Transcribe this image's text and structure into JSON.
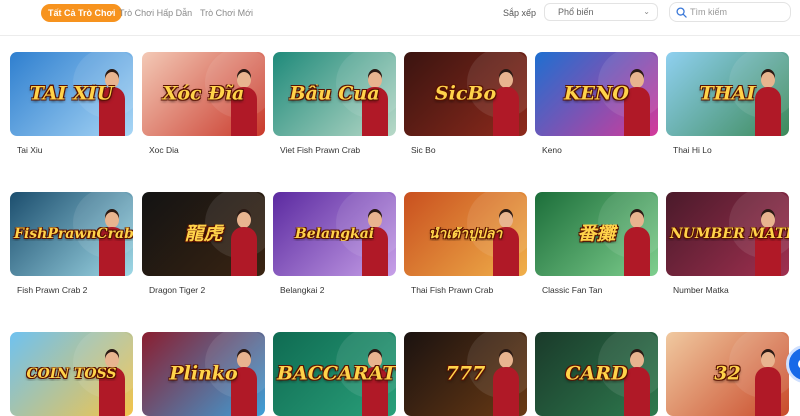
{
  "tabs": [
    {
      "label": "Tất Cả Trò Chơi",
      "active": true
    },
    {
      "label": "Trò Chơi Hấp Dẫn",
      "active": false
    },
    {
      "label": "Trò Chơi Mới",
      "active": false
    }
  ],
  "sort": {
    "label": "Sắp xếp",
    "value": "Phổ biến",
    "icon": "chevron-down-icon"
  },
  "search": {
    "placeholder": "Tìm kiếm",
    "value": "",
    "icon": "search-icon"
  },
  "accent_color": "#f7931e",
  "games": [
    {
      "name": "Tai Xiu",
      "art": "TÀI XỈU",
      "bg": "#2f7fcf",
      "bg2": "#a8d6f5"
    },
    {
      "name": "Xoc Dia",
      "art": "Xóc Đĩa",
      "bg": "#f3c9b6",
      "bg2": "#c9392b"
    },
    {
      "name": "Viet Fish Prawn Crab",
      "art": "Bầu Cua",
      "bg": "#1f8a7a",
      "bg2": "#b8d9c8"
    },
    {
      "name": "Sic Bo",
      "art": "SicBo",
      "bg": "#3a1410",
      "bg2": "#8e2a1c"
    },
    {
      "name": "Keno",
      "art": "KENO",
      "bg": "#1e6fd0",
      "bg2": "#d43a9a"
    },
    {
      "name": "Thai Hi Lo",
      "art": "THAI",
      "bg": "#8fd0f0",
      "bg2": "#3d8a5a"
    },
    {
      "name": "Fish Prawn Crab 2",
      "art": "FishPrawnCrab",
      "bg": "#1c4e6e",
      "bg2": "#9fd8e6"
    },
    {
      "name": "Dragon Tiger 2",
      "art": "龍虎",
      "bg": "#131313",
      "bg2": "#3a2412"
    },
    {
      "name": "Belangkai 2",
      "art": "Belangkai",
      "bg": "#5b2aa0",
      "bg2": "#c7a0e8"
    },
    {
      "name": "Thai Fish Prawn Crab",
      "art": "น้ำเต้าปูปลา",
      "bg": "#c9501f",
      "bg2": "#f0b04a"
    },
    {
      "name": "Classic Fan Tan",
      "art": "番攤",
      "bg": "#1c6e3a",
      "bg2": "#7fcf8e"
    },
    {
      "name": "Number Matka",
      "art": "NUMBER MATKA",
      "bg": "#4a1a2a",
      "bg2": "#a03050"
    },
    {
      "name": "",
      "art": "COIN TOSS",
      "bg": "#6fc2f0",
      "bg2": "#f3c44a"
    },
    {
      "name": "",
      "art": "Plinko",
      "bg": "#8a1e30",
      "bg2": "#3fa0d8"
    },
    {
      "name": "",
      "art": "BACCARAT",
      "bg": "#0f6b52",
      "bg2": "#2aa07a"
    },
    {
      "name": "",
      "art": "777",
      "bg": "#1a1210",
      "bg2": "#6a3a14"
    },
    {
      "name": "",
      "art": "CARD",
      "bg": "#1a3a2a",
      "bg2": "#2e7a4e"
    },
    {
      "name": "",
      "art": "32",
      "bg": "#f0c9a0",
      "bg2": "#c94a2a"
    }
  ]
}
